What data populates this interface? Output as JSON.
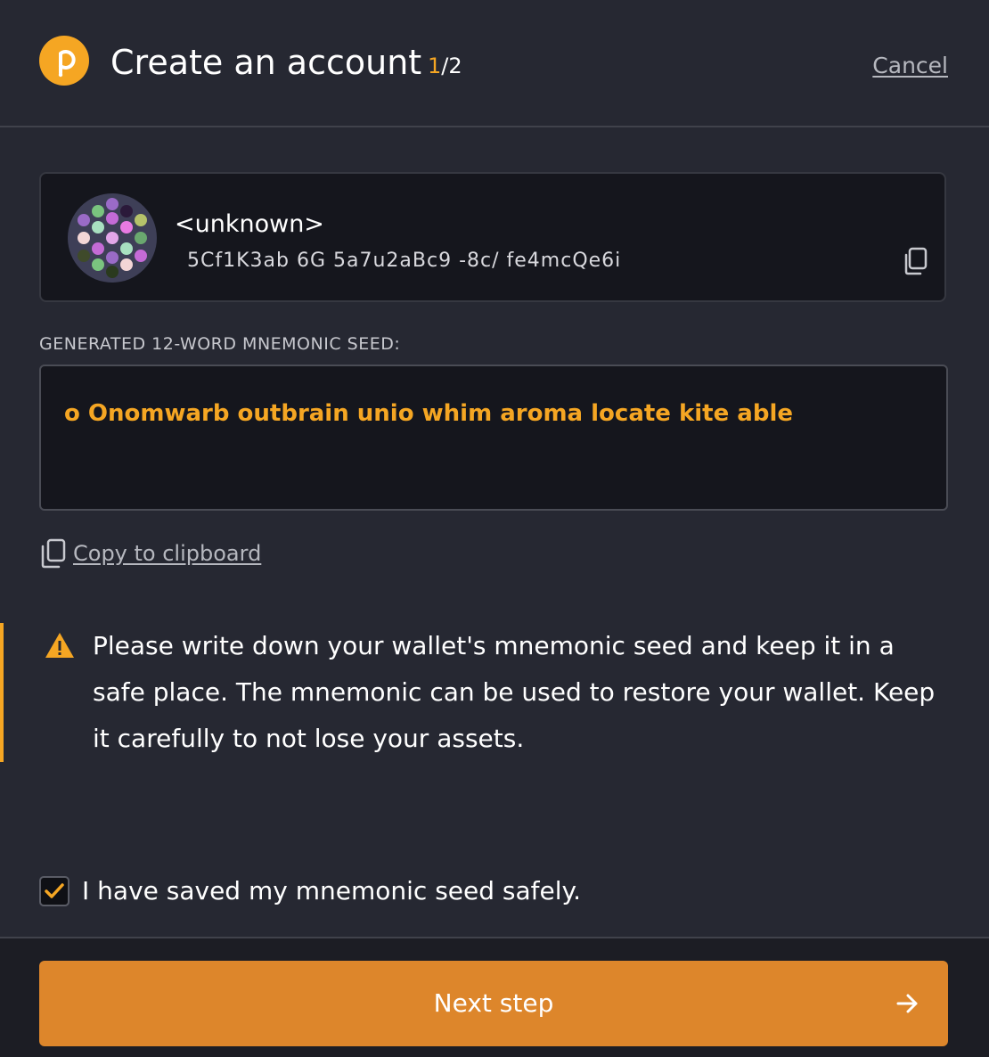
{
  "header": {
    "title": "Create an account",
    "step_current": "1",
    "step_total": "/2",
    "cancel_label": "Cancel"
  },
  "account": {
    "name": "<unknown>",
    "address": "5Cf1K3ab  6G  5a7u2aBc9 -8c/ fe4mcQe6i",
    "icons": {
      "identicon": "identicon-icon",
      "copy": "copy-icon"
    }
  },
  "seed": {
    "label": "GENERATED 12-WORD MNEMONIC SEED:",
    "value": "o  Onomwarb outbrain unio  whim  aroma locate kite able",
    "copy_label": "Copy to clipboard",
    "copy_icon": "copy-icon"
  },
  "warning": {
    "icon": "warning-icon",
    "text": "Please write down your wallet's mnemonic seed and keep it in a safe place. The mnemonic can be used to restore your wallet. Keep it carefully to not lose your assets."
  },
  "confirm": {
    "label": "I have saved my mnemonic seed safely.",
    "checked": true
  },
  "footer": {
    "next_label": "Next step",
    "arrow_icon": "arrow-right-icon"
  },
  "colors": {
    "accent": "#f5a623",
    "button": "#dd862b",
    "background": "#262832",
    "card": "#15161d"
  }
}
